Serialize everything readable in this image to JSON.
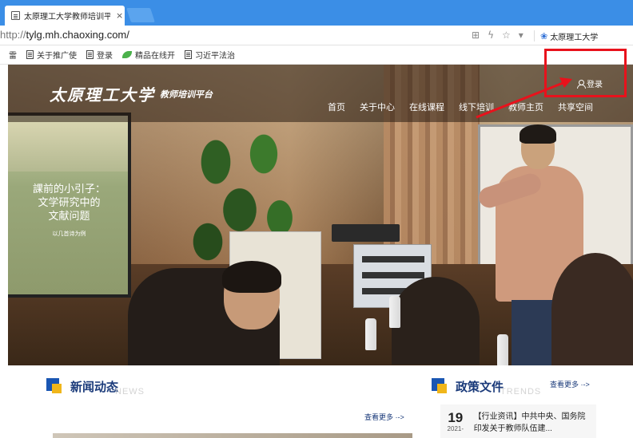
{
  "browser": {
    "tab_title": "太原理工大学教师培训平",
    "url_proto": "http://",
    "url_host": "tylg.mh.chaoxing.com/",
    "site_name": "太原理工大学"
  },
  "bookmarks": [
    {
      "label": "关于推广使"
    },
    {
      "label": "登录"
    },
    {
      "label": "精品在线开"
    },
    {
      "label": "习近平法治"
    }
  ],
  "bookmark_prefix": "雷",
  "site": {
    "logo_calligraphy": "太原理工大学",
    "logo_sub": "教师培训平台",
    "login_label": "登录",
    "nav": [
      "首页",
      "关于中心",
      "在线课程",
      "线下培训",
      "教师主页",
      "共享空间"
    ]
  },
  "hero": {
    "screen_title_lines": [
      "課前的小引子：",
      "文学研究中的",
      "文献问题"
    ],
    "screen_subtitle": "以几首诗为例"
  },
  "news": {
    "title": "新闻动态",
    "title_en": "NEWS",
    "more_label": "查看更多 ·->"
  },
  "policy": {
    "title": "政策文件",
    "title_en": "TRENDS",
    "more_label": "查看更多 ·->",
    "items": [
      {
        "day": "19",
        "year_month": "2021-",
        "text": "【行业资讯】中共中央、国务院印发关于教师队伍建..."
      }
    ]
  },
  "colors": {
    "tab_strip": "#3b8ee6",
    "annotation": "#e8121c",
    "section_blue": "#1a56b3",
    "section_yellow": "#f0b61b"
  }
}
